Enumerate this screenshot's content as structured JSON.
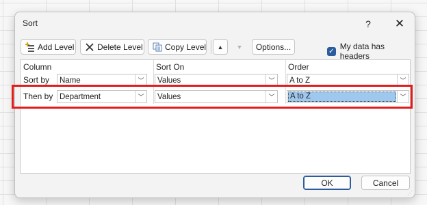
{
  "dialog": {
    "title": "Sort",
    "help_label": "?",
    "close_label": "✕"
  },
  "toolbar": {
    "add_level_label": "Add Level",
    "delete_level_label": "Delete Level",
    "copy_level_label": "Copy Level",
    "move_up_label": "▲",
    "move_down_label": "▼",
    "options_label": "Options...",
    "headers_checkbox_label": "My data has headers",
    "headers_checked": true
  },
  "grid": {
    "headers": [
      "Column",
      "Sort On",
      "Order"
    ],
    "rows": [
      {
        "label": "Sort by",
        "column": "Name",
        "sort_on": "Values",
        "order": "A to Z"
      },
      {
        "label": "Then by",
        "column": "Department",
        "sort_on": "Values",
        "order": "A to Z"
      }
    ]
  },
  "footer": {
    "ok_label": "OK",
    "cancel_label": "Cancel"
  },
  "colors": {
    "accent": "#2d5c9e",
    "highlight_border": "#e31b1b",
    "selection": "#9fc8ef"
  }
}
